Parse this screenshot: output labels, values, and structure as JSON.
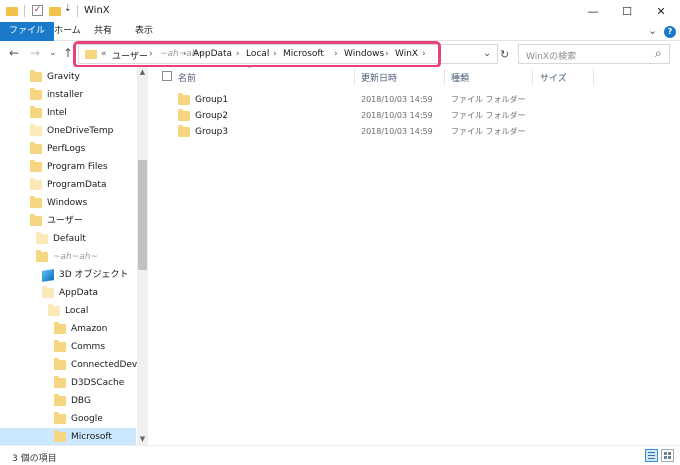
{
  "window": {
    "title": "WinX",
    "controls": {
      "minimize": "—",
      "maximize": "☐",
      "close": "✕"
    }
  },
  "ribbon": {
    "tabs": [
      {
        "label": "ファイル",
        "active": true
      },
      {
        "label": "ホーム"
      },
      {
        "label": "共有"
      },
      {
        "label": "表示"
      }
    ],
    "expand_icon": "⌄",
    "help_icon": "?"
  },
  "nav": {
    "back": "←",
    "forward": "→",
    "dropdown": "⌄",
    "up": "↑"
  },
  "address": {
    "overflow": "«",
    "crumbs": [
      "ユーザー",
      "~ah~ah~",
      "AppData",
      "Local",
      "Microsoft",
      "Windows",
      "WinX"
    ],
    "separator": "›",
    "dropdown": "⌄",
    "refresh": "↻"
  },
  "search": {
    "placeholder": "WinXの検索",
    "icon": "⌕"
  },
  "tree": {
    "items": [
      {
        "label": "Gravity",
        "icon": "folder"
      },
      {
        "label": "installer",
        "icon": "folder"
      },
      {
        "label": "Intel",
        "icon": "folder"
      },
      {
        "label": "OneDriveTemp",
        "icon": "folder-pale"
      },
      {
        "label": "PerfLogs",
        "icon": "folder"
      },
      {
        "label": "Program Files",
        "icon": "folder"
      },
      {
        "label": "ProgramData",
        "icon": "folder-pale"
      },
      {
        "label": "Windows",
        "icon": "folder"
      },
      {
        "label": "ユーザー",
        "icon": "folder"
      },
      {
        "label": "Default",
        "icon": "folder-pale"
      },
      {
        "label": "~ah~ah~",
        "icon": "folder"
      },
      {
        "label": "3D オブジェクト",
        "icon": "3d-objects"
      },
      {
        "label": "AppData",
        "icon": "folder-pale"
      },
      {
        "label": "Local",
        "icon": "folder-pale"
      },
      {
        "label": "Amazon",
        "icon": "folder"
      },
      {
        "label": "Comms",
        "icon": "folder"
      },
      {
        "label": "ConnectedDevice",
        "icon": "folder"
      },
      {
        "label": "D3DSCache",
        "icon": "folder"
      },
      {
        "label": "DBG",
        "icon": "folder"
      },
      {
        "label": "Google",
        "icon": "folder"
      },
      {
        "label": "Microsoft",
        "icon": "folder",
        "selected": true
      }
    ],
    "scroll_up": "▲",
    "scroll_down": "▼"
  },
  "filelist": {
    "columns": [
      "名前",
      "更新日時",
      "種類",
      "サイズ"
    ],
    "rows": [
      {
        "name": "Group1",
        "modified": "2018/10/03 14:59",
        "type": "ファイル フォルダー",
        "size": ""
      },
      {
        "name": "Group2",
        "modified": "2018/10/03 14:59",
        "type": "ファイル フォルダー",
        "size": ""
      },
      {
        "name": "Group3",
        "modified": "2018/10/03 14:59",
        "type": "ファイル フォルダー",
        "size": ""
      }
    ],
    "header_sort_icon": "⌃"
  },
  "status": {
    "item_count": "3 個の項目"
  },
  "colors": {
    "accent": "#1979ca",
    "highlight_border": "#e8417a",
    "folder": "#f6d680",
    "selection": "#cce8ff"
  }
}
